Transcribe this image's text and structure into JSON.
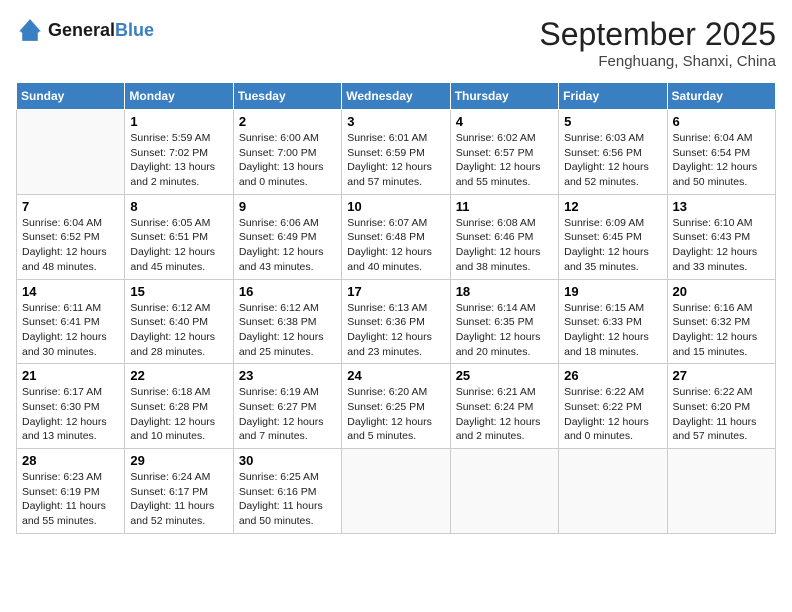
{
  "header": {
    "logo_line1": "General",
    "logo_line2": "Blue",
    "month": "September 2025",
    "location": "Fenghuang, Shanxi, China"
  },
  "days_of_week": [
    "Sunday",
    "Monday",
    "Tuesday",
    "Wednesday",
    "Thursday",
    "Friday",
    "Saturday"
  ],
  "weeks": [
    [
      {
        "day": "",
        "sunrise": "",
        "sunset": "",
        "daylight": ""
      },
      {
        "day": "1",
        "sunrise": "Sunrise: 5:59 AM",
        "sunset": "Sunset: 7:02 PM",
        "daylight": "Daylight: 13 hours and 2 minutes."
      },
      {
        "day": "2",
        "sunrise": "Sunrise: 6:00 AM",
        "sunset": "Sunset: 7:00 PM",
        "daylight": "Daylight: 13 hours and 0 minutes."
      },
      {
        "day": "3",
        "sunrise": "Sunrise: 6:01 AM",
        "sunset": "Sunset: 6:59 PM",
        "daylight": "Daylight: 12 hours and 57 minutes."
      },
      {
        "day": "4",
        "sunrise": "Sunrise: 6:02 AM",
        "sunset": "Sunset: 6:57 PM",
        "daylight": "Daylight: 12 hours and 55 minutes."
      },
      {
        "day": "5",
        "sunrise": "Sunrise: 6:03 AM",
        "sunset": "Sunset: 6:56 PM",
        "daylight": "Daylight: 12 hours and 52 minutes."
      },
      {
        "day": "6",
        "sunrise": "Sunrise: 6:04 AM",
        "sunset": "Sunset: 6:54 PM",
        "daylight": "Daylight: 12 hours and 50 minutes."
      }
    ],
    [
      {
        "day": "7",
        "sunrise": "Sunrise: 6:04 AM",
        "sunset": "Sunset: 6:52 PM",
        "daylight": "Daylight: 12 hours and 48 minutes."
      },
      {
        "day": "8",
        "sunrise": "Sunrise: 6:05 AM",
        "sunset": "Sunset: 6:51 PM",
        "daylight": "Daylight: 12 hours and 45 minutes."
      },
      {
        "day": "9",
        "sunrise": "Sunrise: 6:06 AM",
        "sunset": "Sunset: 6:49 PM",
        "daylight": "Daylight: 12 hours and 43 minutes."
      },
      {
        "day": "10",
        "sunrise": "Sunrise: 6:07 AM",
        "sunset": "Sunset: 6:48 PM",
        "daylight": "Daylight: 12 hours and 40 minutes."
      },
      {
        "day": "11",
        "sunrise": "Sunrise: 6:08 AM",
        "sunset": "Sunset: 6:46 PM",
        "daylight": "Daylight: 12 hours and 38 minutes."
      },
      {
        "day": "12",
        "sunrise": "Sunrise: 6:09 AM",
        "sunset": "Sunset: 6:45 PM",
        "daylight": "Daylight: 12 hours and 35 minutes."
      },
      {
        "day": "13",
        "sunrise": "Sunrise: 6:10 AM",
        "sunset": "Sunset: 6:43 PM",
        "daylight": "Daylight: 12 hours and 33 minutes."
      }
    ],
    [
      {
        "day": "14",
        "sunrise": "Sunrise: 6:11 AM",
        "sunset": "Sunset: 6:41 PM",
        "daylight": "Daylight: 12 hours and 30 minutes."
      },
      {
        "day": "15",
        "sunrise": "Sunrise: 6:12 AM",
        "sunset": "Sunset: 6:40 PM",
        "daylight": "Daylight: 12 hours and 28 minutes."
      },
      {
        "day": "16",
        "sunrise": "Sunrise: 6:12 AM",
        "sunset": "Sunset: 6:38 PM",
        "daylight": "Daylight: 12 hours and 25 minutes."
      },
      {
        "day": "17",
        "sunrise": "Sunrise: 6:13 AM",
        "sunset": "Sunset: 6:36 PM",
        "daylight": "Daylight: 12 hours and 23 minutes."
      },
      {
        "day": "18",
        "sunrise": "Sunrise: 6:14 AM",
        "sunset": "Sunset: 6:35 PM",
        "daylight": "Daylight: 12 hours and 20 minutes."
      },
      {
        "day": "19",
        "sunrise": "Sunrise: 6:15 AM",
        "sunset": "Sunset: 6:33 PM",
        "daylight": "Daylight: 12 hours and 18 minutes."
      },
      {
        "day": "20",
        "sunrise": "Sunrise: 6:16 AM",
        "sunset": "Sunset: 6:32 PM",
        "daylight": "Daylight: 12 hours and 15 minutes."
      }
    ],
    [
      {
        "day": "21",
        "sunrise": "Sunrise: 6:17 AM",
        "sunset": "Sunset: 6:30 PM",
        "daylight": "Daylight: 12 hours and 13 minutes."
      },
      {
        "day": "22",
        "sunrise": "Sunrise: 6:18 AM",
        "sunset": "Sunset: 6:28 PM",
        "daylight": "Daylight: 12 hours and 10 minutes."
      },
      {
        "day": "23",
        "sunrise": "Sunrise: 6:19 AM",
        "sunset": "Sunset: 6:27 PM",
        "daylight": "Daylight: 12 hours and 7 minutes."
      },
      {
        "day": "24",
        "sunrise": "Sunrise: 6:20 AM",
        "sunset": "Sunset: 6:25 PM",
        "daylight": "Daylight: 12 hours and 5 minutes."
      },
      {
        "day": "25",
        "sunrise": "Sunrise: 6:21 AM",
        "sunset": "Sunset: 6:24 PM",
        "daylight": "Daylight: 12 hours and 2 minutes."
      },
      {
        "day": "26",
        "sunrise": "Sunrise: 6:22 AM",
        "sunset": "Sunset: 6:22 PM",
        "daylight": "Daylight: 12 hours and 0 minutes."
      },
      {
        "day": "27",
        "sunrise": "Sunrise: 6:22 AM",
        "sunset": "Sunset: 6:20 PM",
        "daylight": "Daylight: 11 hours and 57 minutes."
      }
    ],
    [
      {
        "day": "28",
        "sunrise": "Sunrise: 6:23 AM",
        "sunset": "Sunset: 6:19 PM",
        "daylight": "Daylight: 11 hours and 55 minutes."
      },
      {
        "day": "29",
        "sunrise": "Sunrise: 6:24 AM",
        "sunset": "Sunset: 6:17 PM",
        "daylight": "Daylight: 11 hours and 52 minutes."
      },
      {
        "day": "30",
        "sunrise": "Sunrise: 6:25 AM",
        "sunset": "Sunset: 6:16 PM",
        "daylight": "Daylight: 11 hours and 50 minutes."
      },
      {
        "day": "",
        "sunrise": "",
        "sunset": "",
        "daylight": ""
      },
      {
        "day": "",
        "sunrise": "",
        "sunset": "",
        "daylight": ""
      },
      {
        "day": "",
        "sunrise": "",
        "sunset": "",
        "daylight": ""
      },
      {
        "day": "",
        "sunrise": "",
        "sunset": "",
        "daylight": ""
      }
    ]
  ]
}
